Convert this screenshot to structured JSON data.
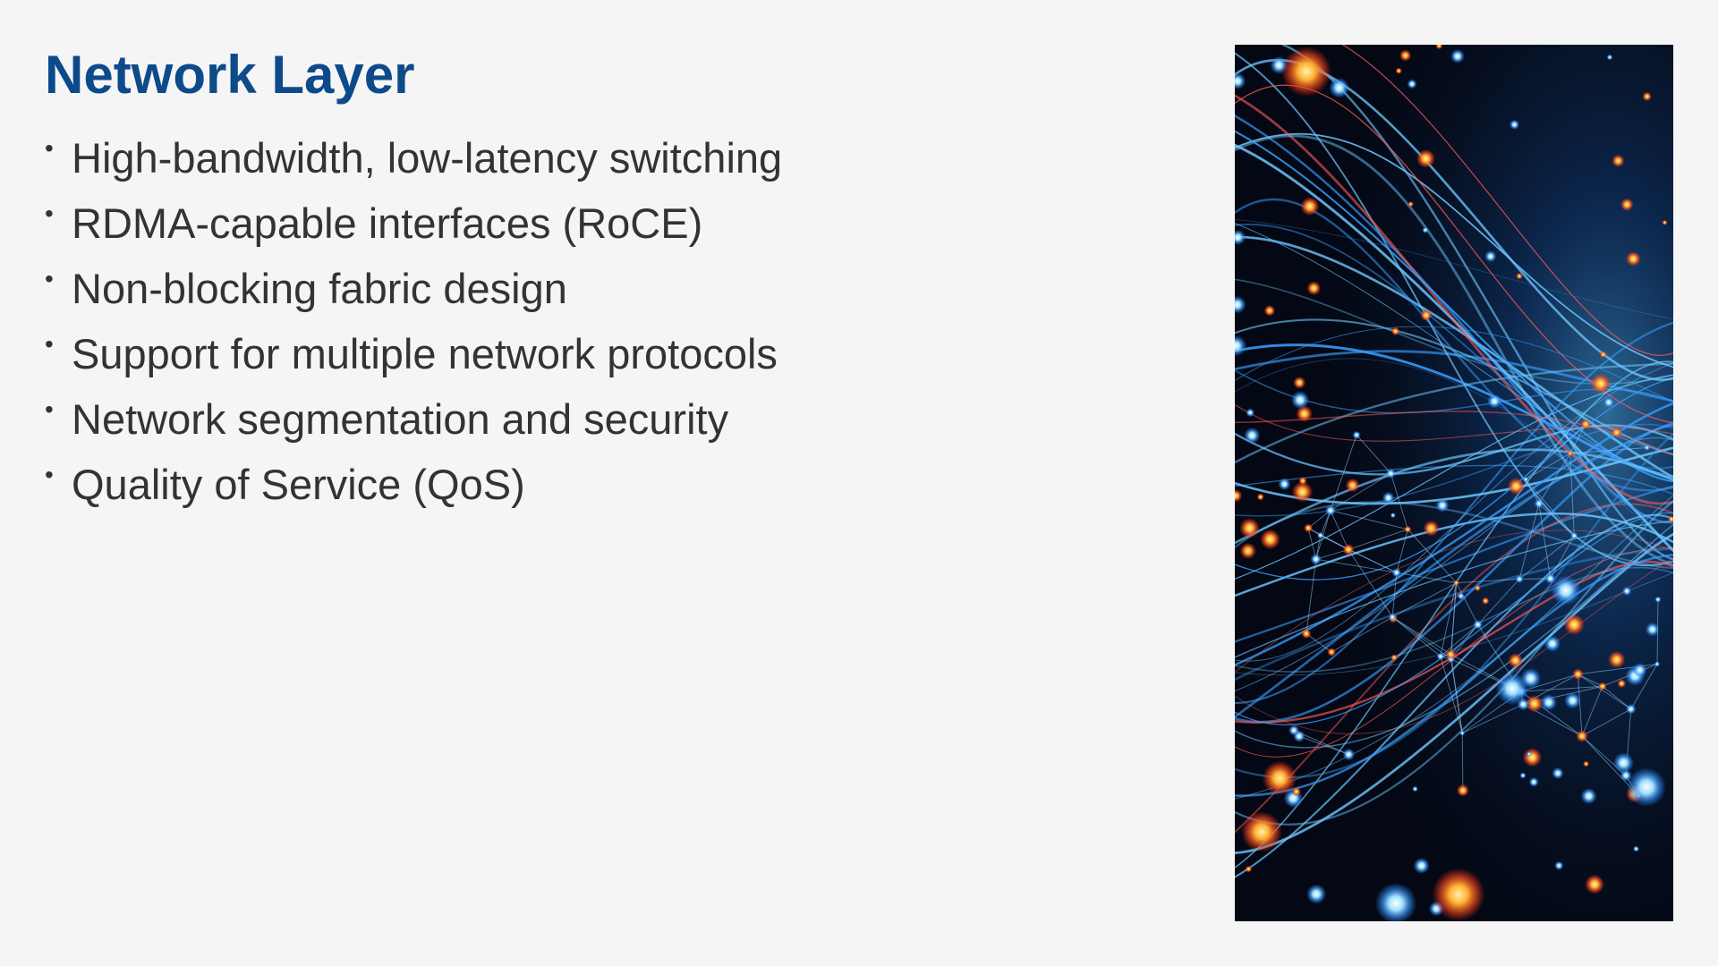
{
  "slide": {
    "title": "Network Layer",
    "bullets": [
      "High-bandwidth, low-latency switching",
      "RDMA-capable interfaces (RoCE)",
      "Non-blocking fabric design",
      "Support for multiple network protocols",
      "Network segmentation and security",
      "Quality of Service (QoS)"
    ],
    "bullet_marker": "•",
    "image": {
      "subject": "glowing network of blue lines and orange nodes",
      "colors": {
        "background": "#040814",
        "line": "#3aa0ff",
        "node_hot": "#ff6a2a",
        "node_cool": "#9fe0ff"
      }
    }
  },
  "colors": {
    "title": "#0d4a8a",
    "body_text": "#333333",
    "background": "#f5f5f5"
  }
}
